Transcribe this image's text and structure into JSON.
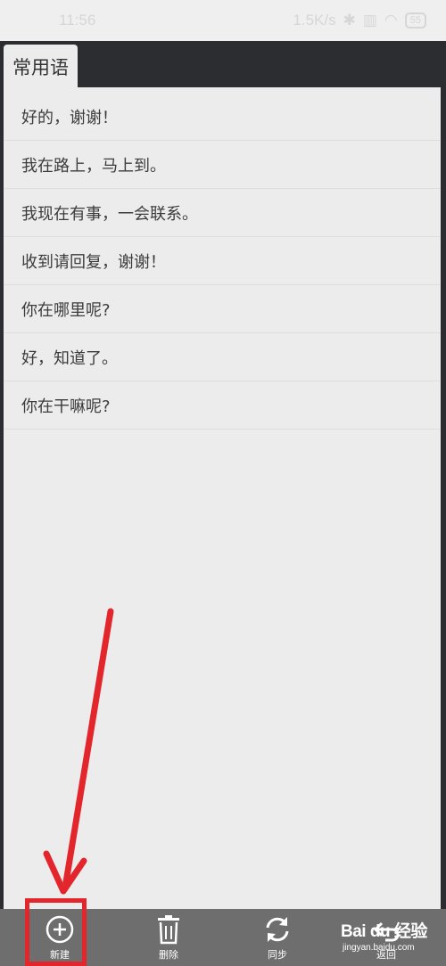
{
  "status_bar": {
    "time": "11:56",
    "network_speed": "1.5K/s",
    "battery": "55"
  },
  "header": {
    "tab_label": "常用语"
  },
  "phrases": [
    "好的，谢谢！",
    "我在路上，马上到。",
    "我现在有事，一会联系。",
    "收到请回复，谢谢！",
    "你在哪里呢?",
    "好，知道了。",
    "你在干嘛呢?"
  ],
  "toolbar": {
    "new_label": "新建",
    "delete_label": "删除",
    "sync_label": "同步",
    "back_label": "返回"
  },
  "watermark": {
    "brand": "Bai du 经验",
    "url": "jingyan.baidu.com"
  },
  "colors": {
    "header_bg": "#2b2d31",
    "toolbar_bg": "#6e6e6e",
    "annotation": "#e3262b"
  }
}
